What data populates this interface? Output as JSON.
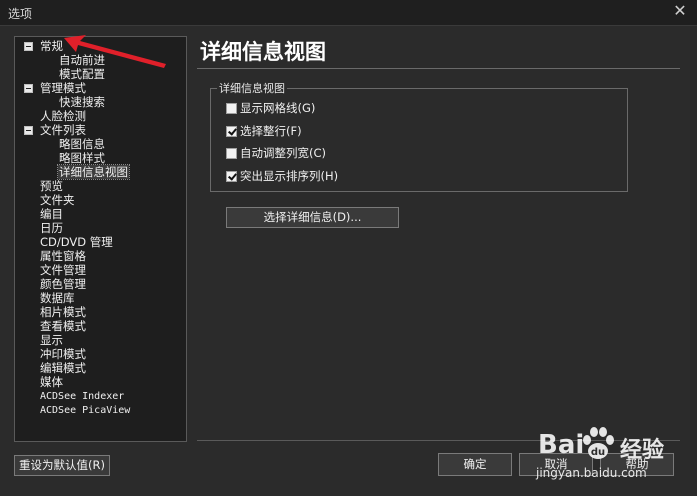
{
  "window": {
    "title": "选项",
    "close_glyph": "✕"
  },
  "tree": {
    "items": [
      {
        "label": "常规",
        "toggle": true
      },
      {
        "label": "自动前进"
      },
      {
        "label": "模式配置"
      },
      {
        "label": "管理模式",
        "toggle": true
      },
      {
        "label": "快速搜索"
      },
      {
        "label": "人脸检测"
      },
      {
        "label": "文件列表",
        "toggle": true
      },
      {
        "label": "略图信息"
      },
      {
        "label": "略图样式"
      },
      {
        "label": "详细信息视图",
        "selected": true
      },
      {
        "label": "预览"
      },
      {
        "label": "文件夹"
      },
      {
        "label": "编目"
      },
      {
        "label": "日历"
      },
      {
        "label": "CD/DVD 管理"
      },
      {
        "label": "属性窗格"
      },
      {
        "label": "文件管理"
      },
      {
        "label": "颜色管理"
      },
      {
        "label": "数据库"
      },
      {
        "label": "相片模式"
      },
      {
        "label": "查看模式"
      },
      {
        "label": "显示"
      },
      {
        "label": "冲印模式"
      },
      {
        "label": "编辑模式"
      },
      {
        "label": "媒体"
      },
      {
        "label": "ACDSee Indexer"
      },
      {
        "label": "ACDSee PicaView"
      }
    ]
  },
  "panel": {
    "title": "详细信息视图",
    "group_label": "详细信息视图",
    "options": [
      {
        "label": "显示网格线(G)",
        "checked": false
      },
      {
        "label": "选择整行(F)",
        "checked": true
      },
      {
        "label": "自动调整列宽(C)",
        "checked": false
      },
      {
        "label": "突出显示排序列(H)",
        "checked": true
      }
    ],
    "details_button": "选择详细信息(D)..."
  },
  "footer": {
    "reset_button": "重设为默认值(R)",
    "ok_button": "确定",
    "cancel_button": "取消",
    "help_button": "帮助"
  },
  "watermark": {
    "brand": "Bai",
    "brand_suffix": "经验",
    "url": "jingyan.baidu.com"
  },
  "colors": {
    "background": "#2b2b2b",
    "tree_background": "#1e1e1e",
    "annotation_arrow": "#e0202a"
  }
}
